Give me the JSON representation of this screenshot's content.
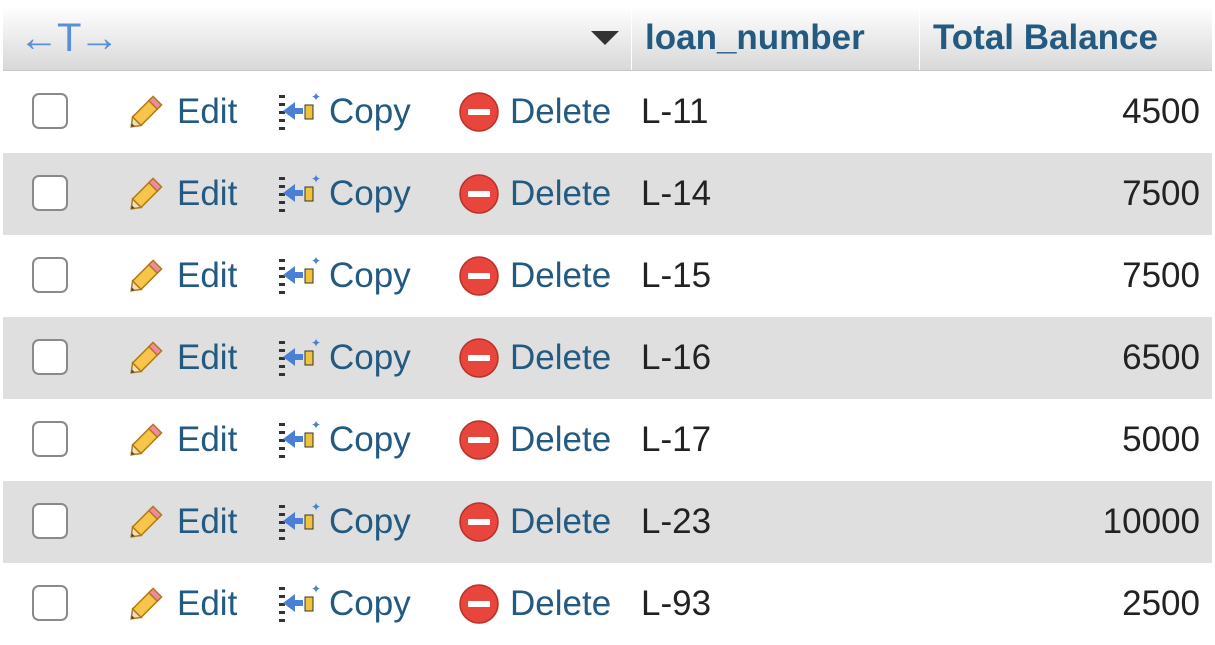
{
  "header": {
    "column_arrows": "←T→",
    "columns": [
      "loan_number",
      "Total Balance"
    ]
  },
  "actions": {
    "edit": "Edit",
    "copy": "Copy",
    "delete": "Delete"
  },
  "rows": [
    {
      "loan_number": "L-11",
      "total_balance": "4500"
    },
    {
      "loan_number": "L-14",
      "total_balance": "7500"
    },
    {
      "loan_number": "L-15",
      "total_balance": "7500"
    },
    {
      "loan_number": "L-16",
      "total_balance": "6500"
    },
    {
      "loan_number": "L-17",
      "total_balance": "5000"
    },
    {
      "loan_number": "L-23",
      "total_balance": "10000"
    },
    {
      "loan_number": "L-93",
      "total_balance": "2500"
    }
  ],
  "colors": {
    "link": "#235a81",
    "row_alt": "#dfdfdf",
    "delete_icon": "#e8453c"
  }
}
